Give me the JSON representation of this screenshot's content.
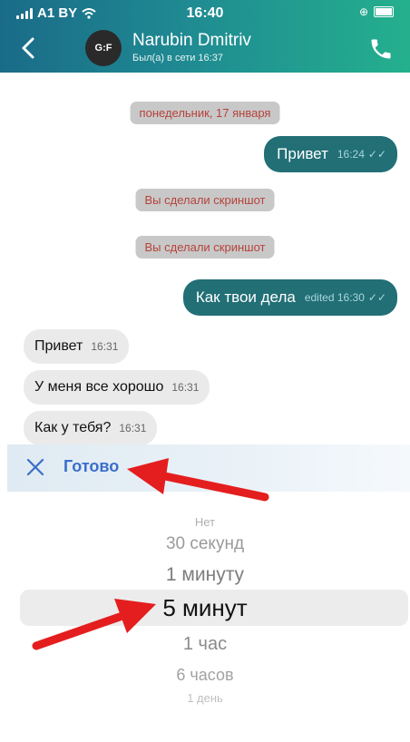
{
  "status_bar": {
    "carrier": "A1 BY",
    "time": "16:40"
  },
  "header": {
    "avatar_text": "G:F",
    "contact_name": "Narubin Dmitriv",
    "contact_status": "Был(а) в сети 16:37"
  },
  "chat": {
    "date_separator": "понедельник, 17 января",
    "messages": [
      {
        "text": "Привет",
        "time": "16:24",
        "direction": "out"
      },
      {
        "system": "Вы сделали скриншот"
      },
      {
        "system": "Вы сделали скриншот"
      },
      {
        "text": "Как твои дела",
        "time": "edited 16:30",
        "direction": "out"
      },
      {
        "text": "Привет",
        "time": "16:31",
        "direction": "in"
      },
      {
        "text": "У меня все хорошо",
        "time": "16:31",
        "direction": "in"
      },
      {
        "text": "Как у тебя?",
        "time": "16:31",
        "direction": "in"
      }
    ]
  },
  "toolbar": {
    "done_label": "Готово"
  },
  "picker": {
    "options": [
      "Нет",
      "30 секунд",
      "1 минуту",
      "5 минут",
      "1 час",
      "6 часов",
      "1 день"
    ],
    "selected": "5 минут"
  },
  "colors": {
    "header_gradient_start": "#1a6b88",
    "header_gradient_end": "#24b08d",
    "outgoing_bubble": "#226f76",
    "system_text": "#b6433b",
    "done_blue": "#3a6fc8",
    "arrow_red": "#e41e1e"
  }
}
